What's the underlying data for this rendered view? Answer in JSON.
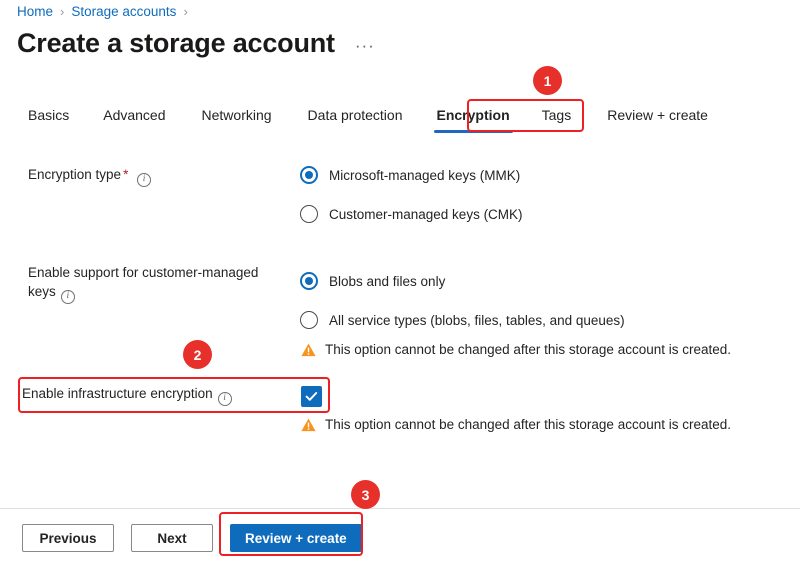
{
  "breadcrumb": {
    "items": [
      {
        "label": "Home"
      },
      {
        "label": "Storage accounts"
      }
    ],
    "separator": "›"
  },
  "header": {
    "title": "Create a storage account",
    "more_label": "···"
  },
  "tabs": [
    {
      "label": "Basics",
      "selected": false
    },
    {
      "label": "Advanced",
      "selected": false
    },
    {
      "label": "Networking",
      "selected": false
    },
    {
      "label": "Data protection",
      "selected": false
    },
    {
      "label": "Encryption",
      "selected": true
    },
    {
      "label": "Tags",
      "selected": false
    },
    {
      "label": "Review + create",
      "selected": false
    }
  ],
  "form": {
    "encryption_type": {
      "label": "Encryption type",
      "required_marker": "*",
      "info": "i",
      "options": [
        {
          "label": "Microsoft-managed keys (MMK)",
          "checked": true
        },
        {
          "label": "Customer-managed keys (CMK)",
          "checked": false
        }
      ]
    },
    "cmk_support": {
      "label": "Enable support for customer-managed keys",
      "info": "i",
      "options": [
        {
          "label": "Blobs and files only",
          "checked": true
        },
        {
          "label": "All service types (blobs, files, tables, and queues)",
          "checked": false
        }
      ],
      "warning": "This option cannot be changed after this storage account is created."
    },
    "infrastructure_encryption": {
      "label": "Enable infrastructure encryption",
      "info": "i",
      "checked": true,
      "check_glyph": "✓",
      "warning": "This option cannot be changed after this storage account is created."
    }
  },
  "footer": {
    "previous_label": "Previous",
    "next_label": "Next",
    "review_create_label": "Review + create"
  },
  "annotations": [
    {
      "number": "1",
      "target": "encryption-tab"
    },
    {
      "number": "2",
      "target": "enable-infrastructure-encryption-row"
    },
    {
      "number": "3",
      "target": "review-create-button"
    }
  ],
  "colors": {
    "accent_blue": "#0f6cbd",
    "link_blue": "#0f6cbd",
    "tab_underline": "#2266c4",
    "annotation_red": "#ed2024",
    "badge_red": "#e8302a",
    "warning_amber": "#f7941d",
    "required_red": "#a4262c"
  }
}
